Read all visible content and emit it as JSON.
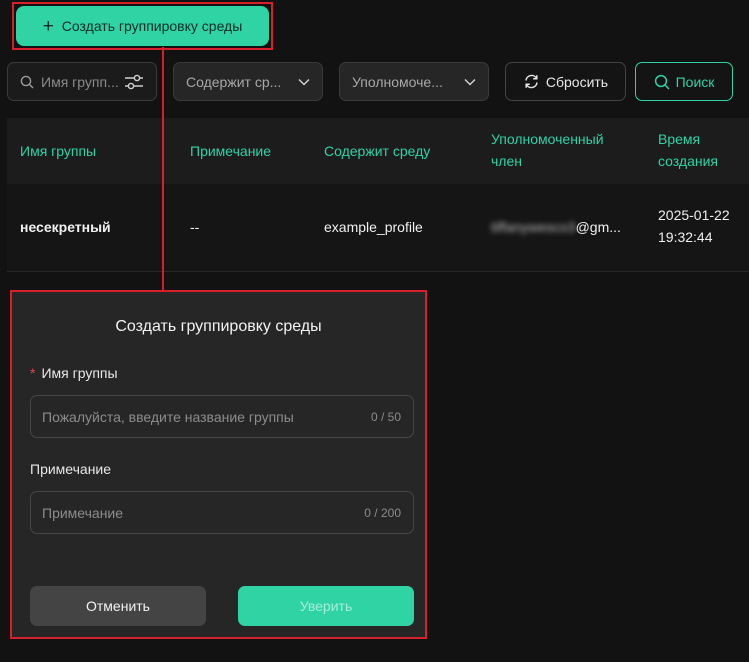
{
  "toolbar": {
    "create_label": "Создать группировку среды"
  },
  "filters": {
    "group_name_placeholder": "Имя групп...",
    "contains_profile_placeholder": "Содержит ср...",
    "authorized_member_placeholder": "Уполномоче...",
    "reset_label": "Сбросить",
    "search_label": "Поиск"
  },
  "table": {
    "columns": [
      "Имя группы",
      "Примечание",
      "Содержит среду",
      "Уполномоченный член",
      "Время создания"
    ],
    "rows": [
      {
        "group_name": "несекретный",
        "note": "--",
        "profile": "example_profile",
        "member_blurred": "tiffanywesco3",
        "member_suffix": "@gm...",
        "created_date": "2025-01-22",
        "created_time": "19:32:44"
      }
    ]
  },
  "dialog": {
    "title": "Создать группировку среды",
    "group_name_label": "Имя группы",
    "required_mark": "*",
    "group_name_placeholder": "Пожалуйста, введите название группы",
    "group_name_counter": "0 / 50",
    "note_label": "Примечание",
    "note_placeholder": "Примечание",
    "note_counter": "0 / 200",
    "cancel_label": "Отменить",
    "confirm_label": "Уверить"
  },
  "colors": {
    "accent": "#2fd3a4",
    "highlight": "#d6212b",
    "background": "#121212"
  }
}
